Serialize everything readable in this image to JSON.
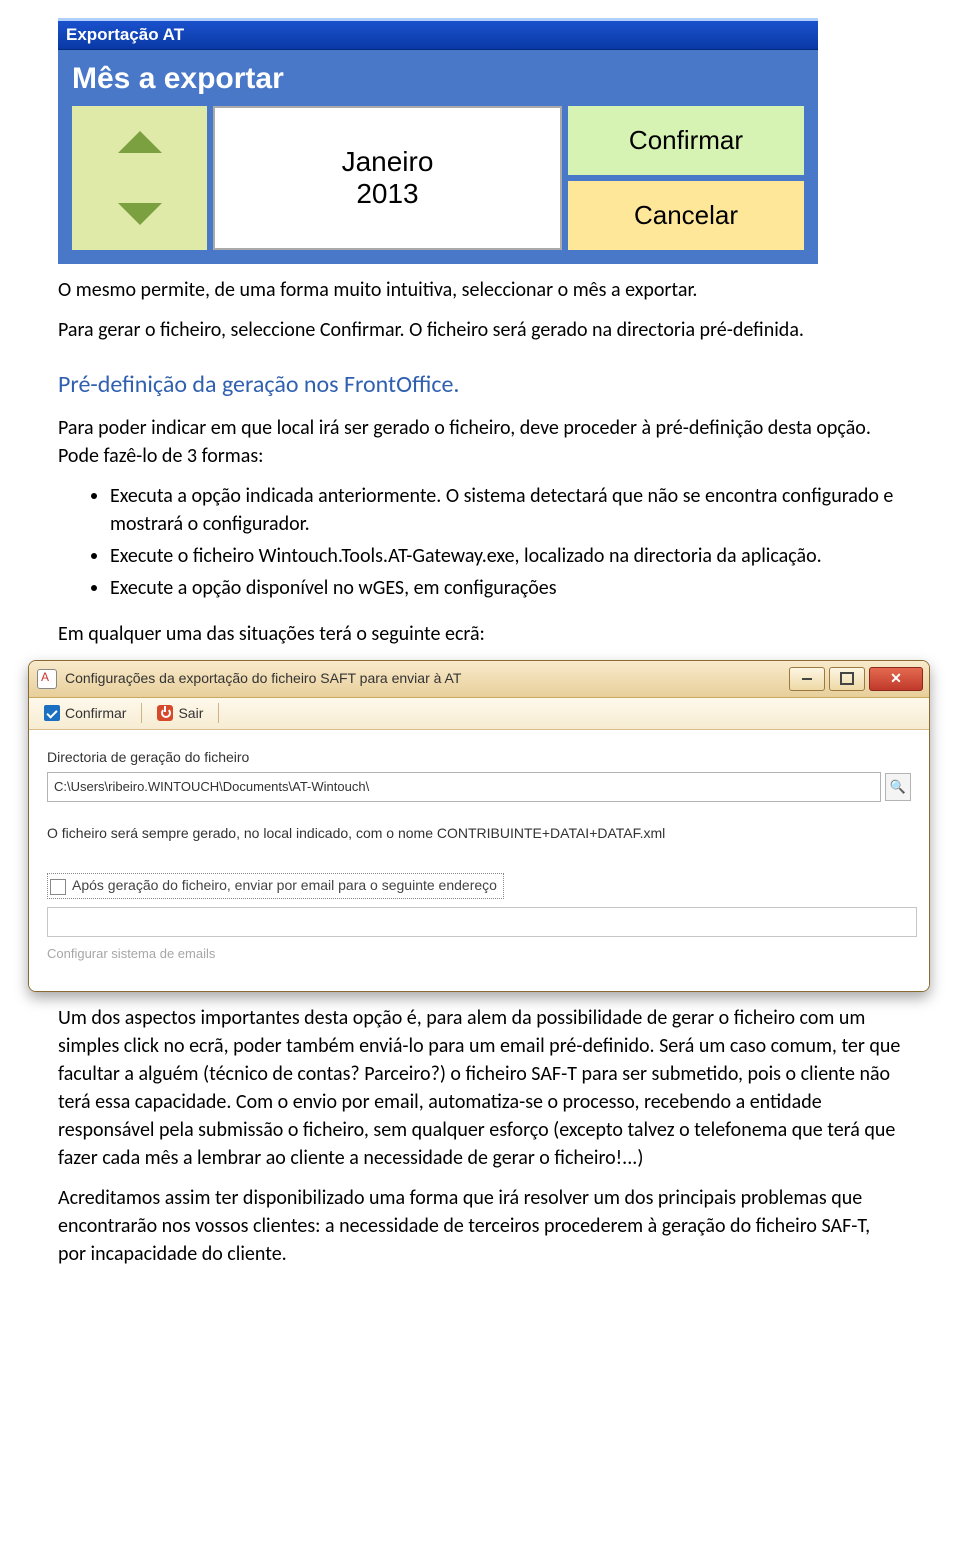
{
  "shot1": {
    "title": "Exportação AT",
    "heading": "Mês a exportar",
    "month": "Janeiro",
    "year": "2013",
    "confirm": "Confirmar",
    "cancel": "Cancelar"
  },
  "doc": {
    "p1": "O mesmo permite, de uma forma muito intuitiva, seleccionar o mês a exportar.",
    "p2": "Para gerar o ficheiro, seleccione Confirmar. O ficheiro será gerado na directoria pré-definida.",
    "h1": "Pré-definição da geração nos FrontOffice.",
    "p3": "Para poder indicar em que local irá ser gerado o ficheiro, deve proceder à pré-definição desta opção. Pode fazê-lo de 3 formas:",
    "b1": "Executa a opção indicada anteriormente. O sistema detectará que não se encontra configurado e mostrará o configurador.",
    "b2": "Execute o ficheiro Wintouch.Tools.AT-Gateway.exe, localizado na directoria da aplicação.",
    "b3": "Execute a opção disponível no wGES, em configurações",
    "p4": "Em qualquer uma das situações terá o seguinte ecrã:",
    "p5": "Um dos aspectos importantes desta opção é, para alem da possibilidade de gerar o ficheiro com um simples click no ecrã, poder também enviá-lo para um email pré-definido. Será um caso comum, ter que facultar a alguém (técnico de contas? Parceiro?) o ficheiro SAF-T para ser submetido, pois o cliente não terá essa capacidade. Com o envio por email, automatiza-se o processo, recebendo a entidade responsável pela submissão o ficheiro, sem qualquer esforço (excepto talvez o telefonema que terá que fazer cada mês a lembrar ao cliente a necessidade de gerar o ficheiro!...)",
    "p6": "Acreditamos assim ter disponibilizado uma forma que irá resolver um dos principais problemas que encontrarão nos vossos clientes: a necessidade de terceiros procederem à geração do ficheiro SAF-T, por incapacidade do cliente."
  },
  "shot2": {
    "title": "Configurações da exportação do ficheiro SAFT para enviar à AT",
    "confirm": "Confirmar",
    "exit": "Sair",
    "dirLabel": "Directoria de geração do ficheiro",
    "dirValue": "C:\\Users\\ribeiro.WINTOUCH\\Documents\\AT-Wintouch\\",
    "note": "O ficheiro será sempre gerado, no local indicado, com o nome CONTRIBUINTE+DATAI+DATAF.xml",
    "chkLabel": "Após geração do ficheiro, enviar por email para o seguinte endereço",
    "confLink": "Configurar sistema de emails",
    "browseGlyph": "🔍"
  }
}
